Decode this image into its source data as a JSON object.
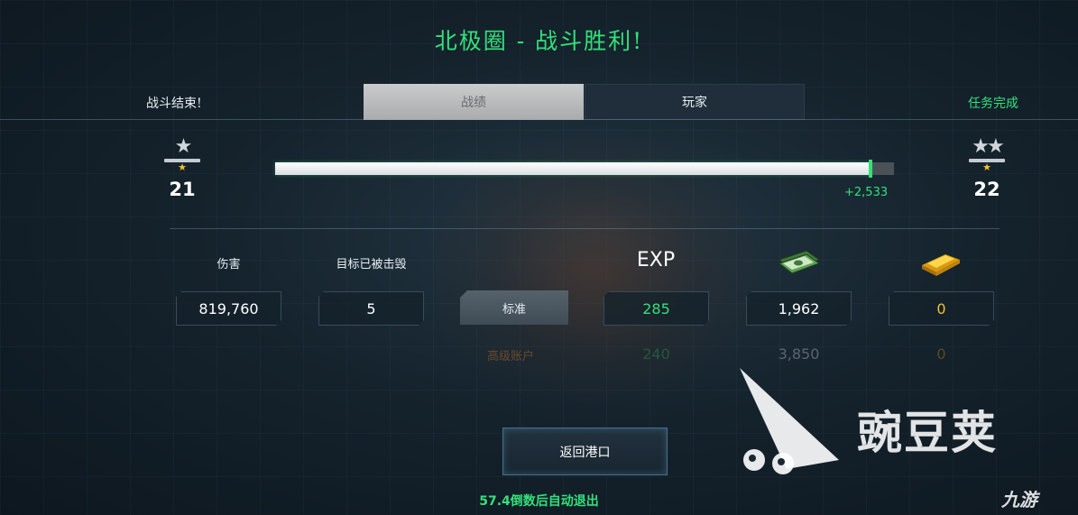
{
  "title": "北极圈 - 战斗胜利!",
  "header": {
    "battle_over": "战斗结束!",
    "mission_complete": "任务完成",
    "tabs": [
      {
        "label": "战绩",
        "active": true
      },
      {
        "label": "玩家",
        "active": false
      }
    ]
  },
  "rank": {
    "current_level": "21",
    "next_level": "22",
    "progress_fraction": 0.962,
    "xp_gain": "+2,533"
  },
  "stats": {
    "damage_label": "伤害",
    "damage_value": "819,760",
    "kills_label": "目标已被击毁",
    "kills_value": "5",
    "exp_label": "EXP",
    "standard_label": "标准",
    "standard": {
      "exp": "285",
      "money": "1,962",
      "gold": "0"
    },
    "premium_label": "高级账户",
    "premium": {
      "exp": "240",
      "money": "3,850",
      "gold": "0"
    }
  },
  "return_button": "返回港口",
  "auto_exit": "57.4倒数后自动退出",
  "watermark": {
    "text": "豌豆荚",
    "sub": "九游"
  },
  "colors": {
    "accent_green": "#33e07a",
    "gold": "#f2c230",
    "premium_text": "#6a4a2c"
  }
}
